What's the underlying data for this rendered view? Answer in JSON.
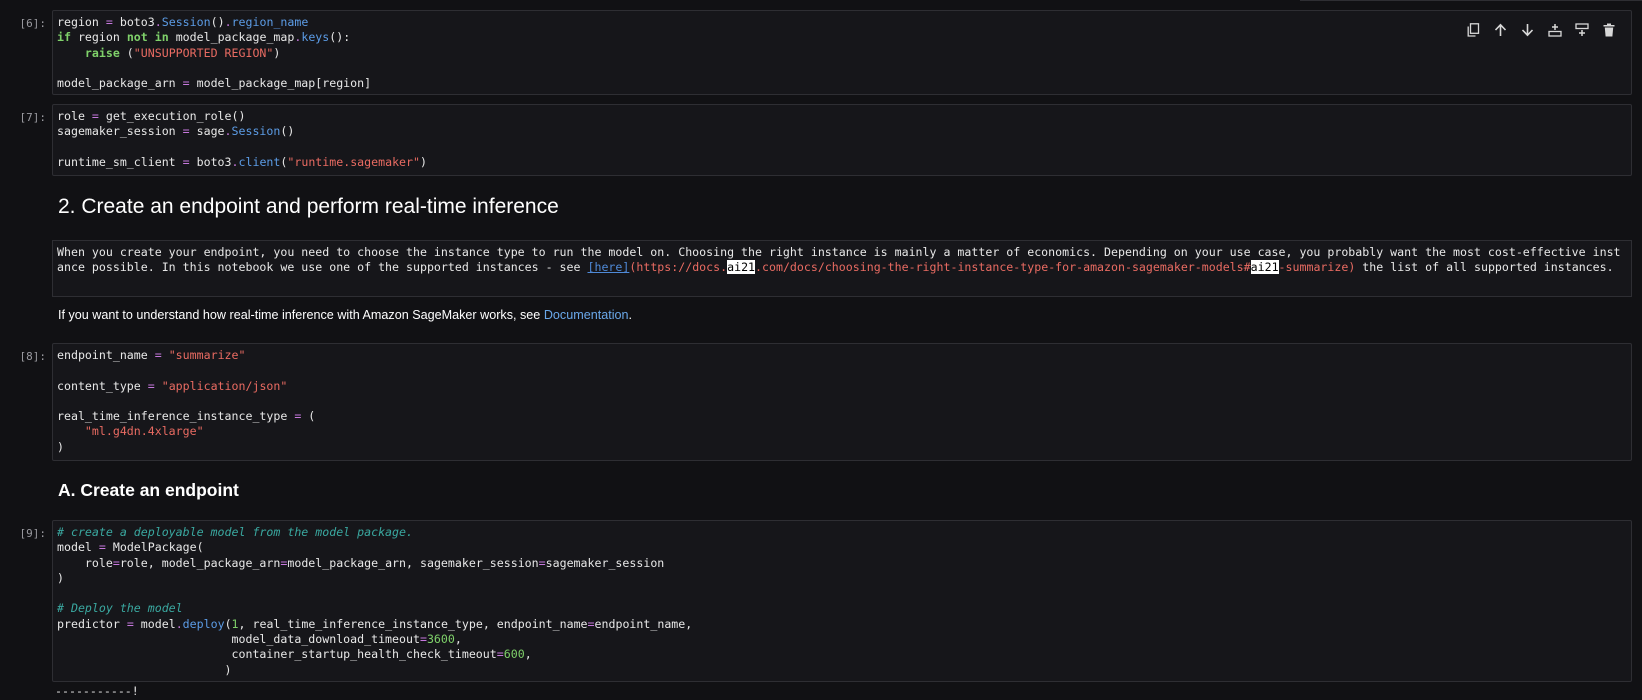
{
  "toolbar": {
    "icons": [
      "duplicate-icon",
      "move-up-icon",
      "move-down-icon",
      "insert-below-icon",
      "insert-above-icon",
      "delete-icon"
    ]
  },
  "cells": {
    "c6": {
      "prompt": "[6]:",
      "lines": [
        "region = boto3.Session().region_name",
        "if region not in model_package_map.keys():",
        "    raise (\"UNSUPPORTED REGION\")",
        "",
        "model_package_arn = model_package_map[region]"
      ]
    },
    "c7": {
      "prompt": "[7]:",
      "lines": [
        "role = get_execution_role()",
        "sagemaker_session = sage.Session()",
        "",
        "runtime_sm_client = boto3.client(\"runtime.sagemaker\")"
      ]
    },
    "heading2": "2. Create an endpoint and perform real-time inference",
    "raw": {
      "text_before": "When you create your endpoint, you need to choose the instance type to run the model on. Choosing the right instance is mainly a matter of economics. Depending on your use case, you probably want the most cost-effective instance possible. In this notebook we use one of the supported instances - see ",
      "link_label": "[here]",
      "url_a": "(https://docs.",
      "url_hl1": "ai21",
      "url_b": ".com/docs/choosing-the-right-instance-type-for-amazon-sagemaker-models#",
      "url_hl2": "ai21",
      "url_c": "-summarize)",
      "text_after": " the list of all supported instances."
    },
    "para": {
      "text": "If you want to understand how real-time inference with Amazon SageMaker works, see ",
      "link": "Documentation",
      "end": "."
    },
    "c8": {
      "prompt": "[8]:",
      "lines": [
        "endpoint_name = \"summarize\"",
        "",
        "content_type = \"application/json\"",
        "",
        "real_time_inference_instance_type = (",
        "    \"ml.g4dn.4xlarge\"",
        ")"
      ]
    },
    "heading3": "A. Create an endpoint",
    "c9": {
      "prompt": "[9]:",
      "lines": [
        "# create a deployable model from the model package.",
        "model = ModelPackage(",
        "    role=role, model_package_arn=model_package_arn, sagemaker_session=sagemaker_session",
        ")",
        "",
        "# Deploy the model",
        "predictor = model.deploy(1, real_time_inference_instance_type, endpoint_name=endpoint_name,",
        "                         model_data_download_timeout=3600,",
        "                         container_startup_health_check_timeout=600,",
        "                        )"
      ],
      "output": "-----------!"
    }
  }
}
